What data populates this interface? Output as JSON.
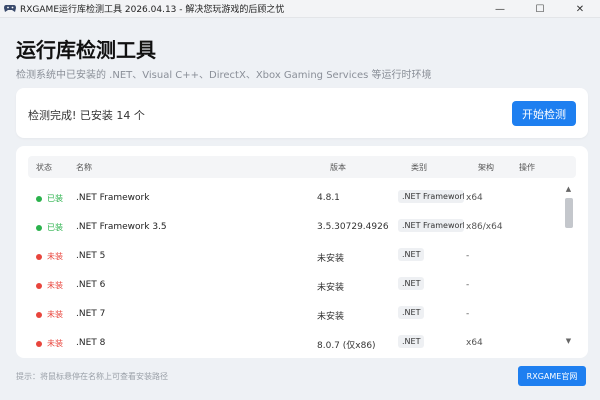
{
  "window": {
    "title": "RXGAME运行库检测工具 2026.04.13 - 解决您玩游戏的后顾之忧",
    "minimize": "—",
    "maximize": "☐",
    "close": "✕"
  },
  "header": {
    "title": "运行库检测工具",
    "subtitle": "检测系统中已安装的 .NET、Visual C++、DirectX、Xbox Gaming Services 等运行时环境"
  },
  "status": {
    "text": "检测完成! 已安装 14 个",
    "start_button": "开始检测"
  },
  "table": {
    "columns": {
      "status": "状态",
      "name": "名称",
      "version": "版本",
      "type": "类别",
      "arch": "架构",
      "action": "操作"
    },
    "rows": [
      {
        "status": "已装",
        "status_color": "#2bb24c",
        "name": ".NET Framework",
        "version": "4.8.1",
        "type": ".NET Framework",
        "arch": "x64"
      },
      {
        "status": "已装",
        "status_color": "#2bb24c",
        "name": ".NET Framework 3.5",
        "version": "3.5.30729.4926",
        "type": ".NET Framework",
        "arch": "x86/x64"
      },
      {
        "status": "未装",
        "status_color": "#e8453c",
        "name": ".NET 5",
        "version": "未安装",
        "type": ".NET",
        "arch": "-"
      },
      {
        "status": "未装",
        "status_color": "#e8453c",
        "name": ".NET 6",
        "version": "未安装",
        "type": ".NET",
        "arch": "-"
      },
      {
        "status": "未装",
        "status_color": "#e8453c",
        "name": ".NET 7",
        "version": "未安装",
        "type": ".NET",
        "arch": "-"
      },
      {
        "status": "未装",
        "status_color": "#e8453c",
        "name": ".NET 8",
        "version": "8.0.7 (仅x86)",
        "type": ".NET",
        "arch": "x64"
      }
    ]
  },
  "footer": {
    "hint": "提示：将鼠标悬停在名称上可查看安装路径",
    "site_button": "RXGAME官网"
  },
  "colors": {
    "accent": "#1e7ff0",
    "installed": "#2bb24c",
    "missing": "#e8453c"
  }
}
